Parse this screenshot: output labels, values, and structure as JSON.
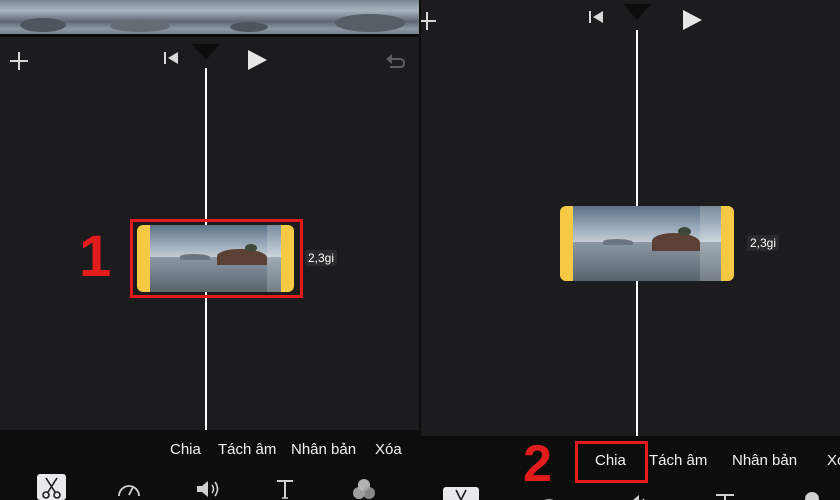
{
  "left_panel": {
    "clip_duration": "2,3gi",
    "step_label": "1",
    "actions": [
      "Chia",
      "Tách âm",
      "Nhân bản",
      "Xóa"
    ],
    "tools": [
      "scissors-icon",
      "speed-icon",
      "volume-icon",
      "text-icon",
      "filters-icon"
    ],
    "selected_tool": "scissors-icon"
  },
  "right_panel": {
    "clip_duration": "2,3gi",
    "step_label": "2",
    "actions": [
      "Chia",
      "Tách âm",
      "Nhân bản",
      "Xó"
    ],
    "highlighted_action": "Chia"
  },
  "colors": {
    "background": "#1c1c1e",
    "bar": "#0d0d0d",
    "clip_accent": "#f6c944",
    "highlight": "#e21b1b",
    "playhead": "#ffffff"
  }
}
